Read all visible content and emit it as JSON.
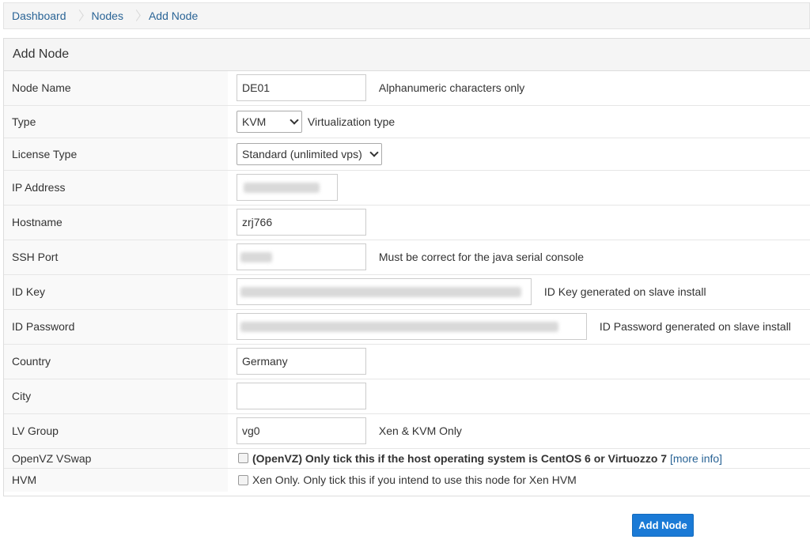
{
  "breadcrumb": [
    "Dashboard",
    "Nodes",
    "Add Node"
  ],
  "panel_title": "Add Node",
  "fields": {
    "node_name": {
      "label": "Node Name",
      "value": "DE01",
      "hint": "Alphanumeric characters only"
    },
    "type": {
      "label": "Type",
      "value": "KVM",
      "hint": "Virtualization type"
    },
    "license_type": {
      "label": "License Type",
      "value": "Standard (unlimited vps)"
    },
    "ip_address": {
      "label": "IP Address",
      "value": ""
    },
    "hostname": {
      "label": "Hostname",
      "value": "zrj766"
    },
    "ssh_port": {
      "label": "SSH Port",
      "value": "",
      "hint": "Must be correct for the java serial console"
    },
    "id_key": {
      "label": "ID Key",
      "value": "",
      "hint": "ID Key generated on slave install"
    },
    "id_password": {
      "label": "ID Password",
      "value": "",
      "hint": "ID Password generated on slave install"
    },
    "country": {
      "label": "Country",
      "value": "Germany"
    },
    "city": {
      "label": "City",
      "value": ""
    },
    "lv_group": {
      "label": "LV Group",
      "value": "vg0",
      "hint": "Xen & KVM Only"
    },
    "openvz_vswap": {
      "label": "OpenVZ VSwap",
      "text": "(OpenVZ) Only tick this if the host operating system is CentOS 6 or Virtuozzo 7",
      "link": "[more info]",
      "checked": false
    },
    "hvm": {
      "label": "HVM",
      "text": "Xen Only. Only tick this if you intend to use this node for Xen HVM",
      "checked": false
    }
  },
  "submit_label": "Add Node",
  "colors": {
    "accent": "#1a7ad6",
    "link": "#2a6496"
  }
}
